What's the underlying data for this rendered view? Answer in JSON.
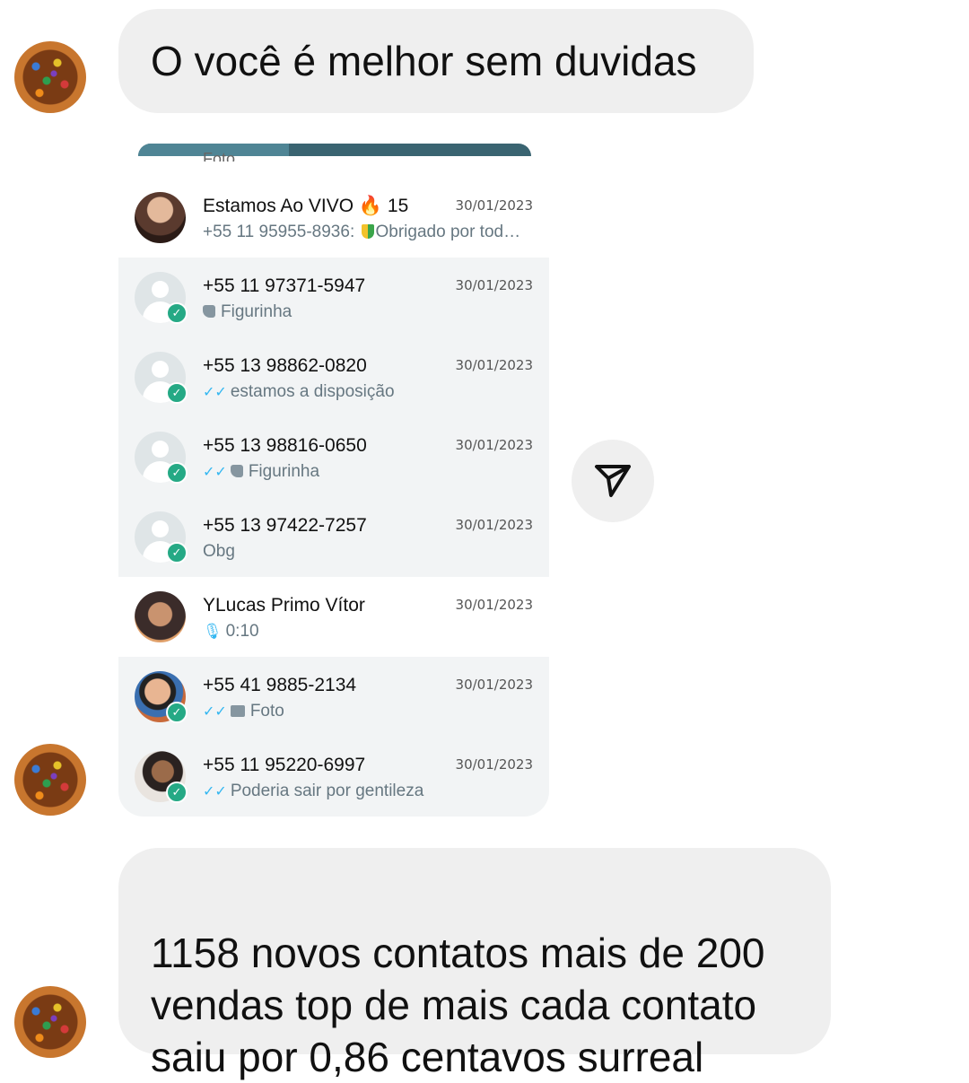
{
  "messages": {
    "first": "O você é  melhor sem duvidas",
    "last": "1158 novos contatos mais de 200\nvendas top de mais cada contato\nsaiu por 0,86 centavos surreal"
  },
  "shared_screenshot": {
    "cutoff_preview": "Foto",
    "chats": [
      {
        "name": "Estamos Ao VIVO",
        "emoji": "🔥",
        "badge_count": "15",
        "date": "30/01/2023",
        "sender": "+55 11 95955-8936: ",
        "preview": "Obrigado por tod…",
        "avatar": "photo1",
        "selected": false,
        "online": false
      },
      {
        "name": "+55 11 97371-5947",
        "date": "30/01/2023",
        "preview": "Figurinha",
        "avatar": "default",
        "selected": true,
        "online": true
      },
      {
        "name": "+55 13 98862-0820",
        "date": "30/01/2023",
        "preview": "estamos a disposição",
        "avatar": "default",
        "selected": true,
        "online": true
      },
      {
        "name": "+55 13 98816-0650",
        "date": "30/01/2023",
        "preview": "Figurinha",
        "avatar": "default",
        "selected": true,
        "online": true
      },
      {
        "name": "+55 13 97422-7257",
        "date": "30/01/2023",
        "preview": "Obg",
        "avatar": "default",
        "selected": true,
        "online": true
      },
      {
        "name": "YLucas Primo Vítor",
        "date": "30/01/2023",
        "preview": "0:10",
        "avatar": "photo2",
        "selected": false,
        "online": false
      },
      {
        "name": "+55 41 9885-2134",
        "date": "30/01/2023",
        "preview": "Foto",
        "avatar": "photo3",
        "selected": true,
        "online": true
      },
      {
        "name": "+55 11 95220-6997",
        "date": "30/01/2023",
        "preview": "Poderia sair por gentileza",
        "avatar": "photo4",
        "selected": true,
        "online": true
      }
    ]
  },
  "icons": {
    "share": "paper-plane-icon",
    "online": "check-icon",
    "read": "double-check-icon",
    "sticker": "sticker-icon",
    "mic": "microphone-icon",
    "photo": "photo-icon",
    "shield": "beginner-shield-icon",
    "flame": "fire-icon"
  },
  "colors": {
    "bubble": "#efefef",
    "accent_green": "#25a985",
    "read_blue": "#34b7f1",
    "selected_row": "#f2f4f5"
  }
}
